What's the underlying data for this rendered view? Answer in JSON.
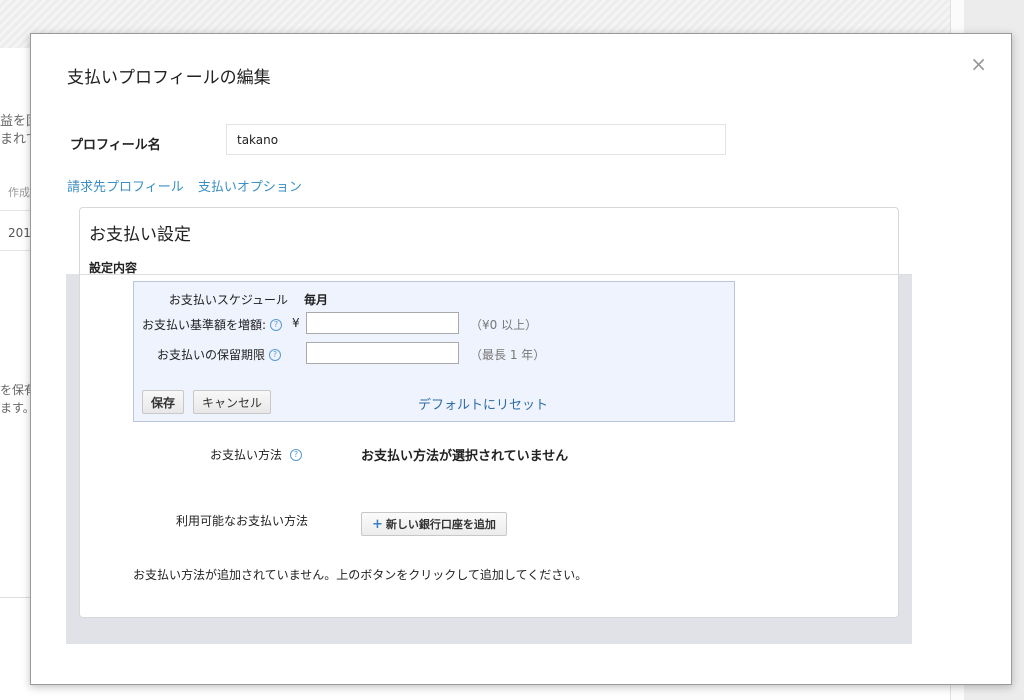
{
  "background": {
    "fragments": [
      "益を固",
      "まれて",
      "作成",
      "201",
      "を保有",
      "ます。"
    ]
  },
  "modal": {
    "title": "支払いプロフィールの編集",
    "close_label": "×",
    "profile_name_label": "プロフィール名",
    "profile_name_value": "takano",
    "links": [
      "請求先プロフィール",
      "支払いオプション"
    ]
  },
  "panel": {
    "title": "お支払い設定",
    "subtitle": "設定内容",
    "settings": {
      "schedule_label": "お支払いスケジュール",
      "schedule_value": "毎月",
      "threshold_label": "お支払い基準額を増額:",
      "currency_symbol": "¥",
      "threshold_value": "",
      "threshold_hint": "（¥0 以上）",
      "hold_label": "お支払いの保留期限",
      "hold_value": "",
      "hold_hint": "（最長 1 年）",
      "help_icon": "?",
      "save_label": "保存",
      "cancel_label": "キャンセル",
      "reset_label": "デフォルトにリセット"
    },
    "payment_method_label": "お支払い方法",
    "payment_method_value": "お支払い方法が選択されていません",
    "available_methods_label": "利用可能なお支払い方法",
    "add_bank_label": "新しい銀行口座を追加",
    "add_icon": "+",
    "note": "お支払い方法が追加されていません。上のボタンをクリックして追加してください。"
  },
  "colors": {
    "link": "#3b8fc4",
    "settings_bg": "#eef3fd",
    "backdrop": "#e1e2e8"
  }
}
